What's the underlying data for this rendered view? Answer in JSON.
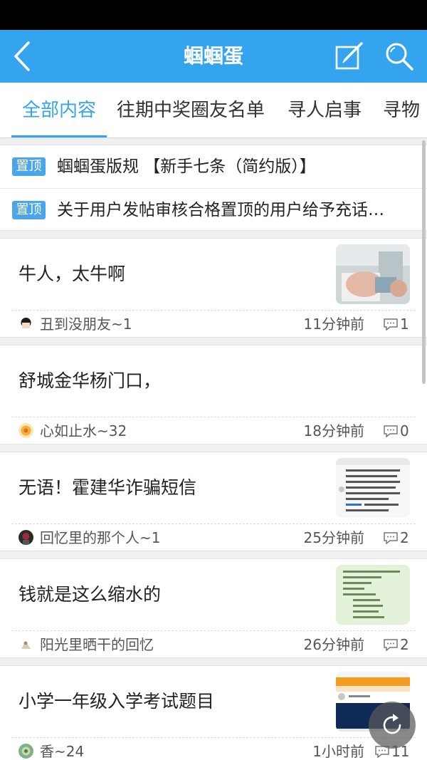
{
  "header": {
    "title": "蝈蝈蛋",
    "background_color": "#35a4ef",
    "back_icon": "chevron-left-icon",
    "compose_icon": "compose-icon",
    "search_icon": "search-icon"
  },
  "tabs": [
    {
      "label": "全部内容",
      "active": true
    },
    {
      "label": "往期中奖圈友名单",
      "active": false
    },
    {
      "label": "寻人启事",
      "active": false
    },
    {
      "label": "寻物",
      "active": false
    }
  ],
  "pinned": [
    {
      "badge": "置顶",
      "title": "蝈蝈蛋版规 【新手七条（简约版）】"
    },
    {
      "badge": "置顶",
      "title": "关于用户发帖审核合格置顶的用户给予充话…"
    }
  ],
  "posts": [
    {
      "title": "牛人，太牛啊",
      "author": "丑到没朋友~1",
      "time": "11分钟前",
      "comments": "1"
    },
    {
      "title": "舒城金华杨门口，",
      "author": "心如止水~32",
      "time": "18分钟前",
      "comments": "0"
    },
    {
      "title": "无语！霍建华诈骗短信",
      "author": "回忆里的那个人~1",
      "time": "25分钟前",
      "comments": "2"
    },
    {
      "title": "钱就是这么缩水的",
      "author": "阳光里晒干的回忆",
      "time": "26分钟前",
      "comments": "2"
    },
    {
      "title": "小学一年级入学考试题目",
      "author": "香~24",
      "time": "1小时前",
      "comments": "11"
    }
  ],
  "accent_color": "#35a4ef"
}
